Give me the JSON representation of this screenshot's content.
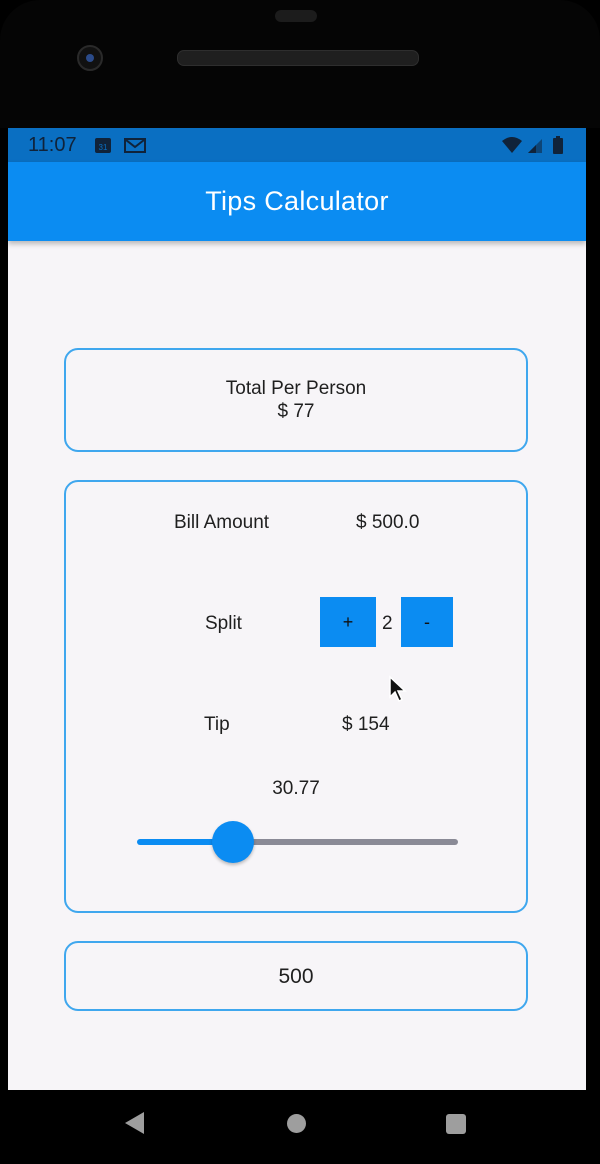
{
  "status_bar": {
    "time": "11:07",
    "calendar_day": "31",
    "icons": [
      "calendar-icon",
      "gmail-icon",
      "wifi-icon",
      "signal-icon",
      "battery-icon"
    ]
  },
  "app_bar": {
    "title": "Tips Calculator",
    "color": "#0b8cf2"
  },
  "total_card": {
    "label": "Total Per Person",
    "value": "$ 77"
  },
  "bill": {
    "label": "Bill Amount",
    "value": "$ 500.0"
  },
  "split": {
    "label": "Split",
    "plus_label": "+",
    "count": "2",
    "minus_label": "-"
  },
  "tip": {
    "label": "Tip",
    "value": "$ 154"
  },
  "slider": {
    "value_text": "30.77",
    "level_fraction": 0.31
  },
  "input": {
    "value": "500"
  },
  "nav": {
    "icons": [
      "back-icon",
      "home-icon",
      "recent-apps-icon"
    ]
  },
  "colors": {
    "accent": "#0b8cf2",
    "card_border": "#3fa7ee",
    "background": "#f7f5f8"
  }
}
